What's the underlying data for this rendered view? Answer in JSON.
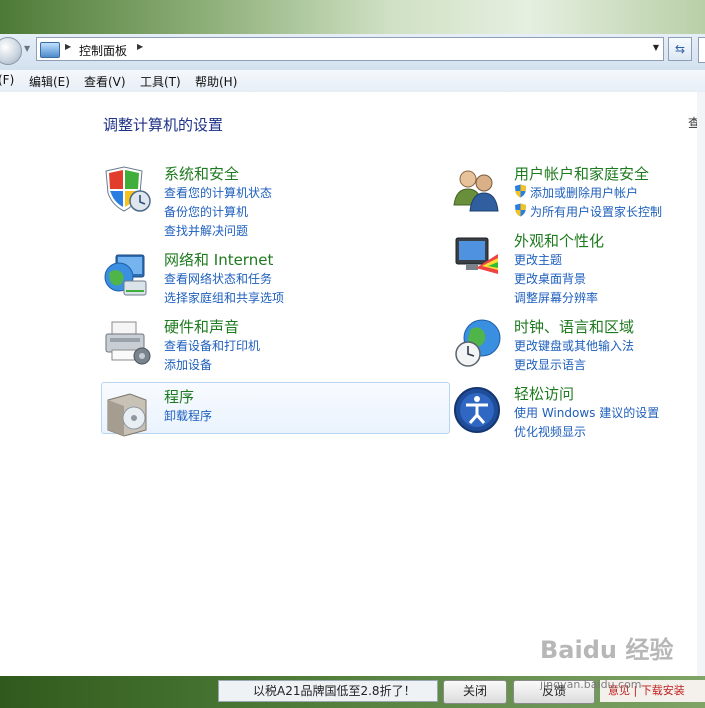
{
  "address": {
    "location": "控制面板"
  },
  "menubar": {
    "file": "(F)",
    "edit": "编辑(E)",
    "view": "查看(V)",
    "tools": "工具(T)",
    "help": "帮助(H)"
  },
  "main": {
    "title": "调整计算机的设置",
    "view_by": "查看",
    "categories": [
      {
        "title": "系统和安全",
        "links": [
          "查看您的计算机状态",
          "备份您的计算机",
          "查找并解决问题"
        ]
      },
      {
        "title": "网络和 Internet",
        "links": [
          "查看网络状态和任务",
          "选择家庭组和共享选项"
        ]
      },
      {
        "title": "硬件和声音",
        "links": [
          "查看设备和打印机",
          "添加设备"
        ]
      },
      {
        "title": "程序",
        "links": [
          "卸载程序"
        ]
      },
      {
        "title": "用户帐户和家庭安全",
        "links": [
          "添加或删除用户帐户",
          "为所有用户设置家长控制"
        ]
      },
      {
        "title": "外观和个性化",
        "links": [
          "更改主题",
          "更改桌面背景",
          "调整屏幕分辨率"
        ]
      },
      {
        "title": "时钟、语言和区域",
        "links": [
          "更改键盘或其他输入法",
          "更改显示语言"
        ]
      },
      {
        "title": "轻松访问",
        "links": [
          "使用 Windows 建议的设置",
          "优化视频显示"
        ]
      }
    ]
  },
  "taskbar": {
    "notice": "以税A21品牌国低至2.8折了！",
    "close_btn": "关闭",
    "feedback_btn": "反馈",
    "tray": "意见  | 下载安装"
  },
  "watermark": {
    "logo": "Baidu 经验",
    "url": "jingyan.baidu.com"
  }
}
